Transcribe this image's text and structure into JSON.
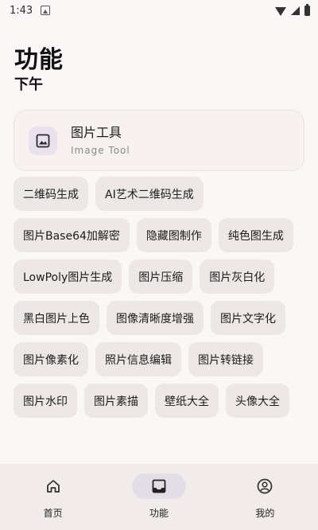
{
  "status_bar": {
    "time": "1:43"
  },
  "header": {
    "title": "功能",
    "subtitle": "下午"
  },
  "tool_card": {
    "title": "图片工具",
    "subtitle": "Image Tool",
    "icon": "image-icon"
  },
  "chips": [
    "二维码生成",
    "AI艺术二维码生成",
    "图片Base64加解密",
    "隐藏图制作",
    "纯色图生成",
    "LowPoly图片生成",
    "图片压缩",
    "图片灰白化",
    "黑白图片上色",
    "图像清晰度增强",
    "图片文字化",
    "图片像素化",
    "照片信息编辑",
    "图片转链接",
    "图片水印",
    "图片素描",
    "壁纸大全",
    "头像大全"
  ],
  "bottom_nav": {
    "items": [
      {
        "label": "首页",
        "icon": "home-icon",
        "active": false
      },
      {
        "label": "功能",
        "icon": "inbox-icon",
        "active": true
      },
      {
        "label": "我的",
        "icon": "profile-icon",
        "active": false
      }
    ]
  },
  "colors": {
    "background": "#fbf7f6",
    "chip": "#ede7e6",
    "nav_active_pill": "#e3dde7"
  }
}
